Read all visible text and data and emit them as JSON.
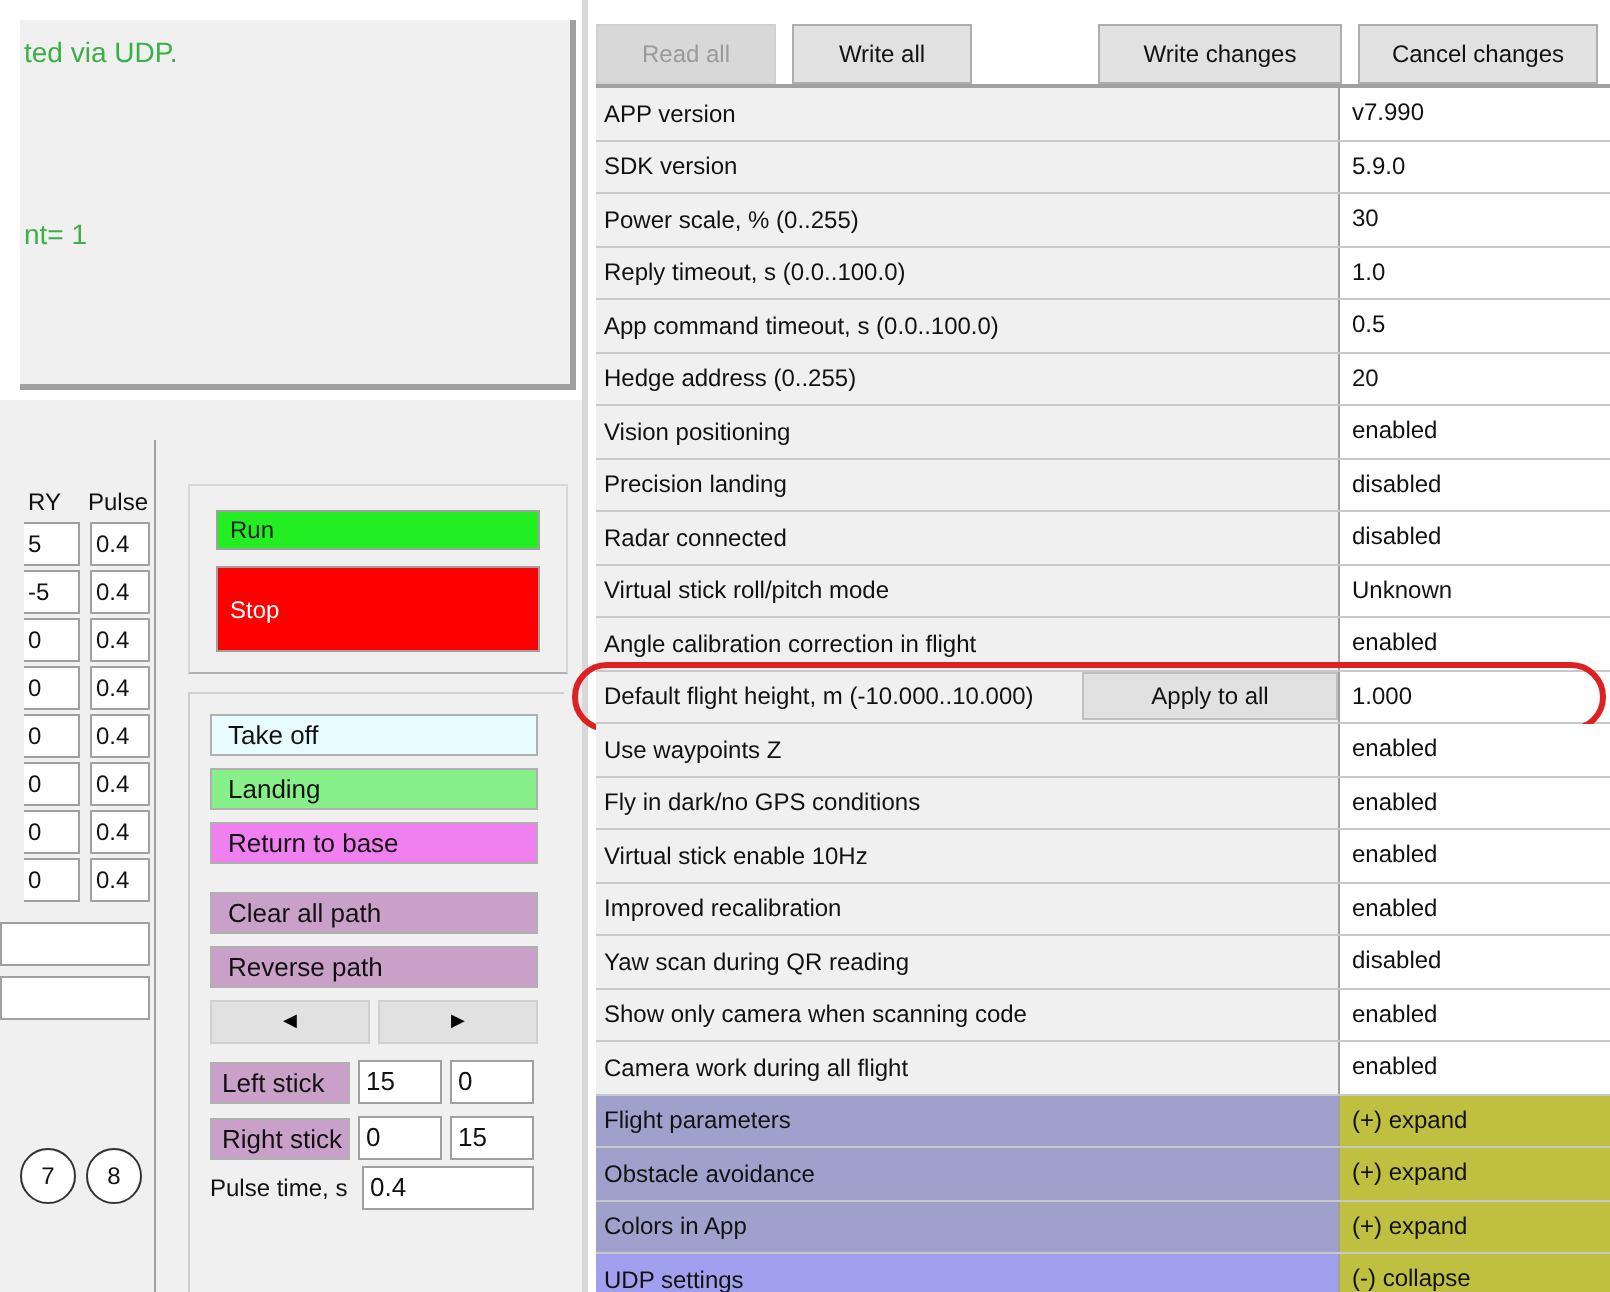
{
  "log": {
    "lines": [
      "ted via UDP.",
      "nt= 1"
    ]
  },
  "pulse_table": {
    "columns": [
      "RY",
      "Pulse"
    ],
    "rows": [
      [
        "5",
        "0.4"
      ],
      [
        "-5",
        "0.4"
      ],
      [
        "0",
        "0.4"
      ],
      [
        "0",
        "0.4"
      ],
      [
        "0",
        "0.4"
      ],
      [
        "0",
        "0.4"
      ],
      [
        "0",
        "0.4"
      ],
      [
        "0",
        "0.4"
      ]
    ]
  },
  "waypoint_circles": [
    "7",
    "8"
  ],
  "run_group": [
    {
      "label": "Run",
      "color": "#22ee22"
    },
    {
      "label": "Stop",
      "color": "#ff0000"
    }
  ],
  "command_buttons": [
    {
      "label": "Take off",
      "color": "#e8fcff"
    },
    {
      "label": "Landing",
      "color": "#88f088"
    },
    {
      "label": "Return to base",
      "color": "#f080f0"
    }
  ],
  "path_buttons": [
    {
      "label": "Clear all path",
      "color": "#c8a0c8"
    },
    {
      "label": "Reverse path",
      "color": "#c8a0c8"
    }
  ],
  "arrow_buttons": [
    "◀",
    "▶"
  ],
  "sticks": [
    {
      "label": "Left stick",
      "values": [
        "15",
        "0"
      ]
    },
    {
      "label": "Right stick",
      "values": [
        "0",
        "15"
      ]
    }
  ],
  "pulse_time": {
    "label": "Pulse time, s",
    "value": "0.4"
  },
  "toolbar": [
    {
      "label": "Read all",
      "disabled": true
    },
    {
      "label": "Write all",
      "disabled": false
    },
    {
      "label": "Write changes",
      "disabled": false
    },
    {
      "label": "Cancel changes",
      "disabled": false
    }
  ],
  "settings": [
    {
      "kind": "setting",
      "label": "APP version",
      "value": "v7.990"
    },
    {
      "kind": "setting",
      "label": "SDK version",
      "value": "5.9.0"
    },
    {
      "kind": "setting",
      "label": "Power scale, % (0..255)",
      "value": "30"
    },
    {
      "kind": "setting",
      "label": "Reply timeout, s (0.0..100.0)",
      "value": "1.0"
    },
    {
      "kind": "setting",
      "label": "App command timeout, s (0.0..100.0)",
      "value": "0.5"
    },
    {
      "kind": "setting",
      "label": "Hedge address (0..255)",
      "value": "20"
    },
    {
      "kind": "setting",
      "label": "Vision positioning",
      "value": "enabled"
    },
    {
      "kind": "setting",
      "label": "Precision landing",
      "value": "disabled"
    },
    {
      "kind": "setting",
      "label": "Radar connected",
      "value": "disabled"
    },
    {
      "kind": "setting",
      "label": "Virtual stick roll/pitch mode",
      "value": "Unknown"
    },
    {
      "kind": "setting",
      "label": "Angle calibration correction in flight",
      "value": "enabled"
    },
    {
      "kind": "action",
      "label": "Default flight height, m (-10.000..10.000)",
      "button": "Apply to all",
      "value": "1.000",
      "highlighted": true
    },
    {
      "kind": "setting",
      "label": "Use waypoints Z",
      "value": "enabled"
    },
    {
      "kind": "setting",
      "label": "Fly in dark/no GPS conditions",
      "value": "enabled"
    },
    {
      "kind": "setting",
      "label": "Virtual stick enable 10Hz",
      "value": "enabled"
    },
    {
      "kind": "setting",
      "label": "Improved recalibration",
      "value": "enabled"
    },
    {
      "kind": "setting",
      "label": "Yaw scan during QR reading",
      "value": "disabled"
    },
    {
      "kind": "setting",
      "label": "Show only camera when scanning code",
      "value": "enabled"
    },
    {
      "kind": "setting",
      "label": "Camera work during all flight",
      "value": "enabled"
    },
    {
      "kind": "group",
      "label": "Flight parameters",
      "value": "(+) expand",
      "expanded": false
    },
    {
      "kind": "group",
      "label": "Obstacle avoidance",
      "value": "(+) expand",
      "expanded": false
    },
    {
      "kind": "group",
      "label": "Colors in App",
      "value": "(+) expand",
      "expanded": false
    },
    {
      "kind": "group",
      "label": "UDP settings",
      "value": "(-) collapse",
      "expanded": true
    }
  ]
}
